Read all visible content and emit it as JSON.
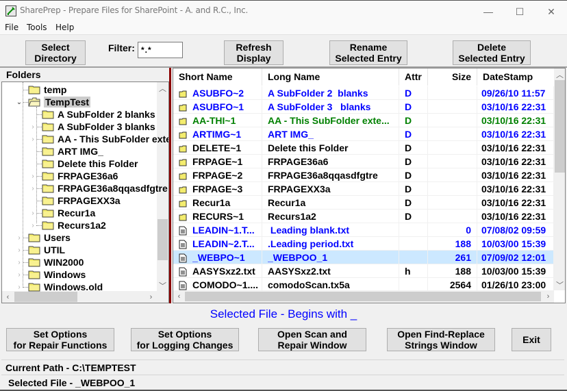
{
  "window": {
    "title": "SharePrep - Prepare Files for SharePoint - A. and R.C., Inc.",
    "controls": {
      "minimize": "—",
      "maximize": "☐",
      "close": "✕"
    }
  },
  "menu": [
    "File",
    "Tools",
    "Help"
  ],
  "toolbar": {
    "select_directory": [
      "Select",
      "Directory"
    ],
    "filter_label": "Filter:",
    "filter_value": "*.*",
    "refresh": [
      "Refresh",
      "Display"
    ],
    "rename": [
      "Rename",
      "Selected Entry"
    ],
    "delete": [
      "Delete",
      "Selected Entry"
    ]
  },
  "folders": {
    "label": "Folders",
    "items": [
      {
        "label": "temp",
        "level": 1,
        "expander": "none"
      },
      {
        "label": "TempTest",
        "level": 1,
        "expander": "open",
        "selected": true
      },
      {
        "label": "A SubFolder 2  blanks",
        "level": 2,
        "expander": "none"
      },
      {
        "label": "A SubFolder 3   blanks",
        "level": 2,
        "expander": "closed"
      },
      {
        "label": "AA - This SubFolder extends",
        "level": 2,
        "expander": "closed"
      },
      {
        "label": "ART IMG_",
        "level": 2,
        "expander": "none"
      },
      {
        "label": "Delete this Folder",
        "level": 2,
        "expander": "none"
      },
      {
        "label": "FRPAGE36a6",
        "level": 2,
        "expander": "closed"
      },
      {
        "label": "FRPAGE36a8qqasdfgtre",
        "level": 2,
        "expander": "closed"
      },
      {
        "label": "FRPAGEXX3a",
        "level": 2,
        "expander": "none"
      },
      {
        "label": "Recur1a",
        "level": 2,
        "expander": "closed"
      },
      {
        "label": "Recurs1a2",
        "level": 2,
        "expander": "closed"
      },
      {
        "label": "Users",
        "level": 1,
        "expander": "closed"
      },
      {
        "label": "UTIL",
        "level": 1,
        "expander": "closed"
      },
      {
        "label": "WIN2000",
        "level": 1,
        "expander": "closed"
      },
      {
        "label": "Windows",
        "level": 1,
        "expander": "closed"
      },
      {
        "label": "Windows.old",
        "level": 1,
        "expander": "closed"
      }
    ]
  },
  "file_list": {
    "columns": [
      "Short Name",
      "Long Name",
      "Attr",
      "Size",
      "DateStamp"
    ],
    "colors": {
      "blue": "#0000ff",
      "green": "#008000",
      "black": "#000000"
    },
    "rows": [
      {
        "type": "folder",
        "short": "ASUBFO~2",
        "long": "A SubFolder 2  blanks",
        "attr": "D",
        "size": "",
        "date": "09/26/10 11:57",
        "color": "blue"
      },
      {
        "type": "folder",
        "short": "ASUBFO~1",
        "long": "A SubFolder 3   blanks",
        "attr": "D",
        "size": "",
        "date": "03/10/16 22:31",
        "color": "blue"
      },
      {
        "type": "folder",
        "short": "AA-THI~1",
        "long": "AA - This SubFolder exte...",
        "attr": "D",
        "size": "",
        "date": "03/10/16 22:31",
        "color": "green"
      },
      {
        "type": "folder",
        "short": "ARTIMG~1",
        "long": "ART IMG_",
        "attr": "D",
        "size": "",
        "date": "03/10/16 22:31",
        "color": "blue"
      },
      {
        "type": "folder",
        "short": "DELETE~1",
        "long": "Delete this Folder",
        "attr": "D",
        "size": "",
        "date": "03/10/16 22:31",
        "color": "black"
      },
      {
        "type": "folder",
        "short": "FRPAGE~1",
        "long": "FRPAGE36a6",
        "attr": "D",
        "size": "",
        "date": "03/10/16 22:31",
        "color": "black"
      },
      {
        "type": "folder",
        "short": "FRPAGE~2",
        "long": "FRPAGE36a8qqasdfgtre",
        "attr": "D",
        "size": "",
        "date": "03/10/16 22:31",
        "color": "black"
      },
      {
        "type": "folder",
        "short": "FRPAGE~3",
        "long": "FRPAGEXX3a",
        "attr": "D",
        "size": "",
        "date": "03/10/16 22:31",
        "color": "black"
      },
      {
        "type": "folder",
        "short": "Recur1a",
        "long": "Recur1a",
        "attr": "D",
        "size": "",
        "date": "03/10/16 22:31",
        "color": "black"
      },
      {
        "type": "folder",
        "short": "RECURS~1",
        "long": "Recurs1a2",
        "attr": "D",
        "size": "",
        "date": "03/10/16 22:31",
        "color": "black"
      },
      {
        "type": "file",
        "short": "LEADIN~1.T...",
        "long": " Leading blank.txt",
        "attr": "",
        "size": "0",
        "date": "07/08/02 09:59",
        "color": "blue"
      },
      {
        "type": "file",
        "short": "LEADIN~2.T...",
        "long": ".Leading period.txt",
        "attr": "",
        "size": "188",
        "date": "10/03/00 15:39",
        "color": "blue"
      },
      {
        "type": "file",
        "short": "_WEBPO~1",
        "long": "_WEBPOO_1",
        "attr": "",
        "size": "261",
        "date": "07/09/02 12:01",
        "color": "blue",
        "selected": true
      },
      {
        "type": "file",
        "short": "AASYSxz2.txt",
        "long": "AASYSxz2.txt",
        "attr": "h",
        "size": "188",
        "date": "10/03/00 15:39",
        "color": "black"
      },
      {
        "type": "file",
        "short": "COMODO~1....",
        "long": "comodoScan.tx5a",
        "attr": "",
        "size": "2564",
        "date": "01/26/10 23:00",
        "color": "black"
      }
    ]
  },
  "selected_message": "Selected File - Begins with _",
  "actions": {
    "repair_options": [
      "Set Options",
      "for Repair Functions"
    ],
    "logging_options": [
      "Set Options",
      "for Logging Changes"
    ],
    "scan_repair": [
      "Open Scan and",
      "Repair Window"
    ],
    "find_replace": [
      "Open Find-Replace",
      "Strings Window"
    ],
    "exit": "Exit"
  },
  "status": {
    "current_path": "Current Path - C:\\TEMPTEST",
    "selected_file": "Selected File  -  _WEBPOO_1"
  }
}
